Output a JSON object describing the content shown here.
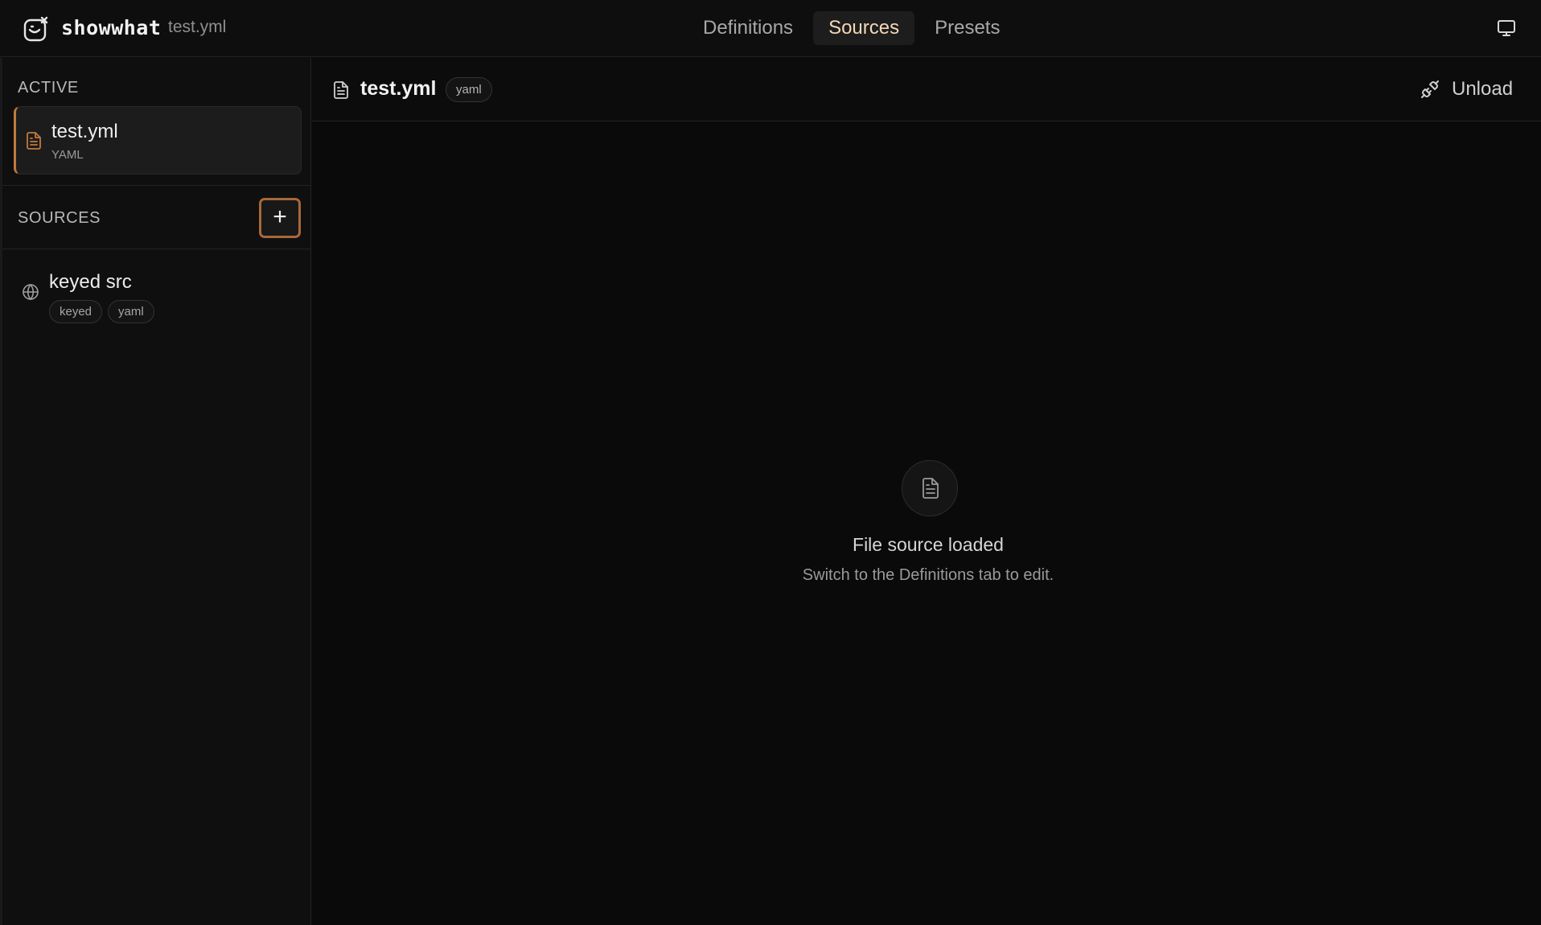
{
  "app": {
    "name": "showwhat",
    "file_name": "test.yml"
  },
  "nav": {
    "tabs": [
      {
        "label": "Definitions",
        "active": false
      },
      {
        "label": "Sources",
        "active": true
      },
      {
        "label": "Presets",
        "active": false
      }
    ]
  },
  "sidebar": {
    "active_label": "ACTIVE",
    "active_item": {
      "title": "test.yml",
      "subtitle": "YAML"
    },
    "sources_label": "SOURCES",
    "add_label": "+",
    "sources": [
      {
        "title": "keyed src",
        "tags": [
          "keyed",
          "yaml"
        ],
        "icon": "globe-icon"
      }
    ]
  },
  "main": {
    "title": "test.yml",
    "badge": "yaml",
    "unload_label": "Unload",
    "empty_title": "File source loaded",
    "empty_subtitle": "Switch to the Definitions tab to edit."
  },
  "colors": {
    "accent": "#c07a3c",
    "active_tab_text": "#f3d9b6",
    "background": "#0b0b0b"
  }
}
